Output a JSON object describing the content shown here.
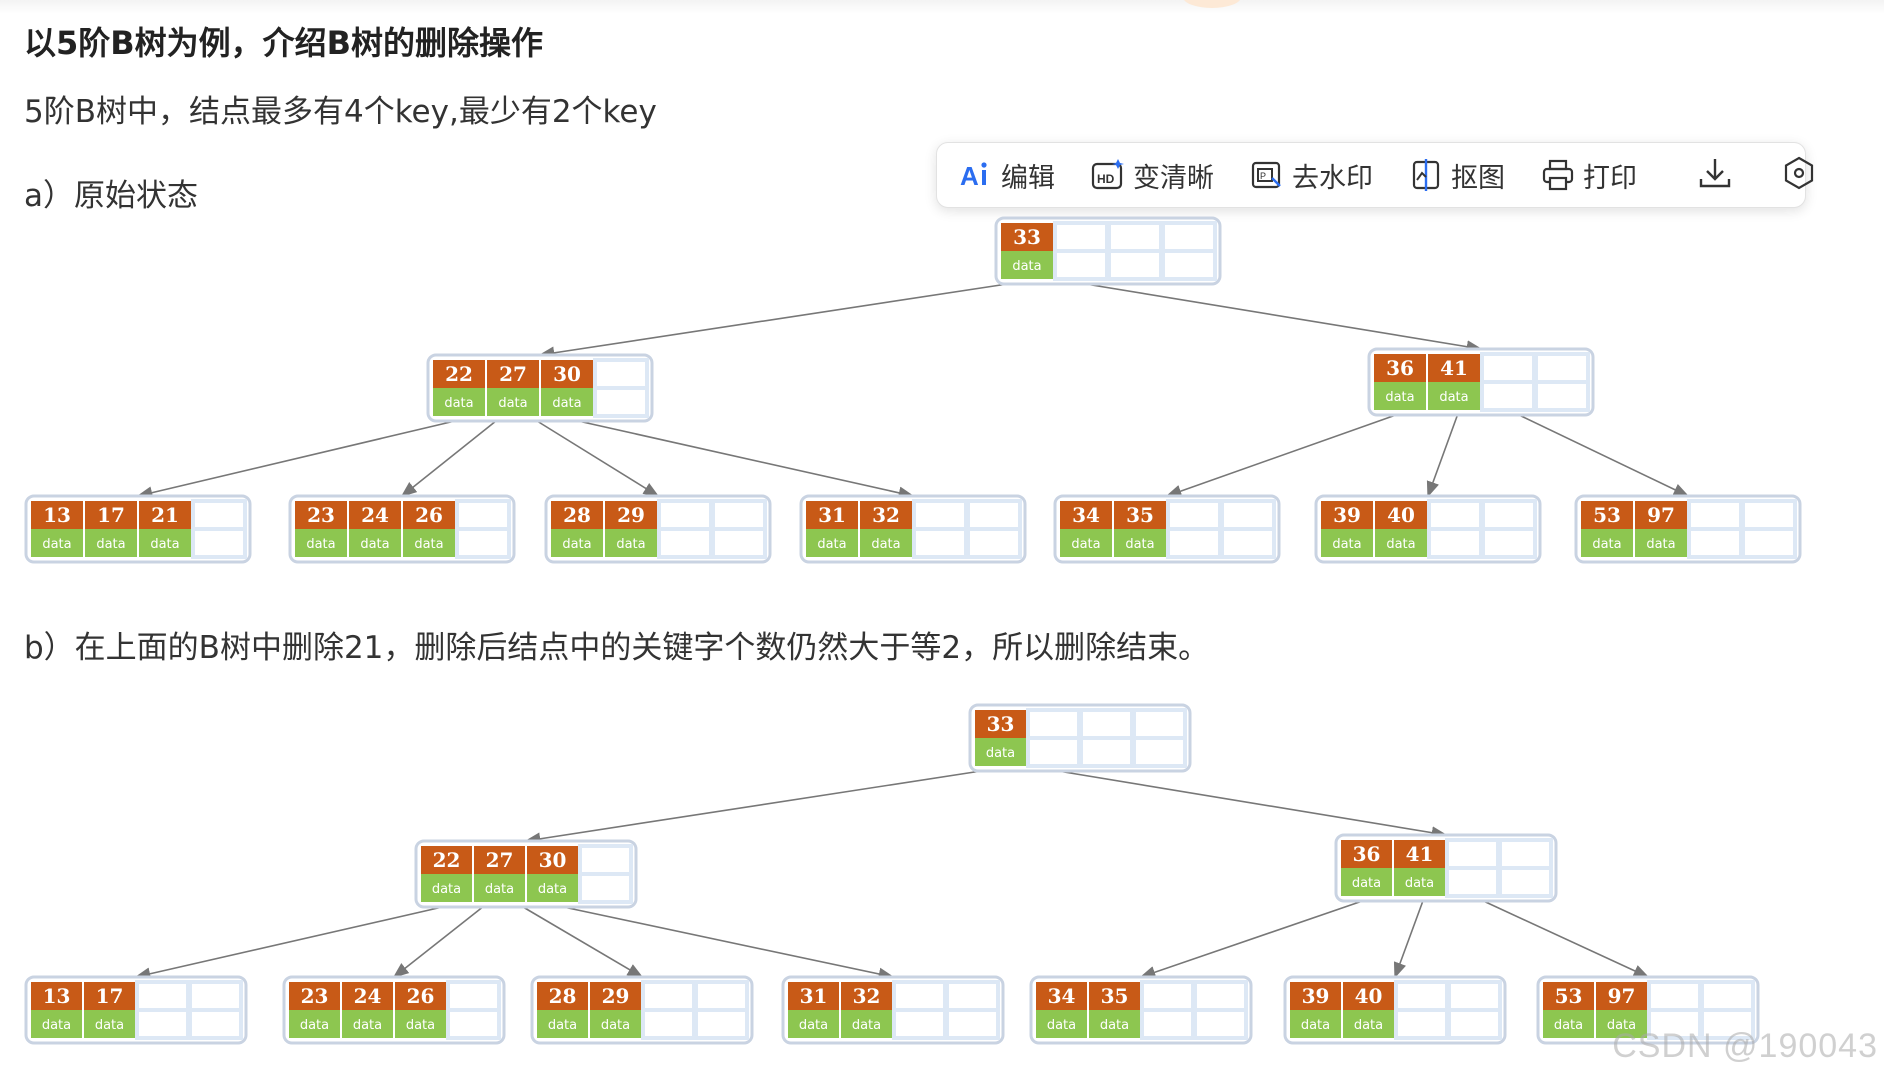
{
  "article": {
    "heading": "以5阶B树为例，介绍B树的删除操作",
    "line1": "5阶B树中，结点最多有4个key,最少有2个key",
    "label_a": "a）原始状态",
    "label_b": "b）在上面的B树中删除21，删除后结点中的关键字个数仍然大于等2，所以删除结束。"
  },
  "toolbar": {
    "edit": "编辑",
    "enhance": "变清晰",
    "remove_watermark": "去水印",
    "cutout": "抠图",
    "print": "打印",
    "accent_color": "#2b6df0",
    "icons": [
      "ai-edit-icon",
      "hd-icon",
      "watermark-remove-icon",
      "cutout-icon",
      "printer-icon",
      "download-icon",
      "settings-hexagon-icon"
    ]
  },
  "watermark": "CSDN @190043",
  "colors": {
    "key_cell": "#c85a17",
    "data_cell": "#8dc650",
    "empty_cell": "#dde8f5",
    "node_border": "#c9d3e2",
    "edge": "#777777"
  },
  "trees": [
    {
      "id": "a",
      "data_label": "data",
      "nodes": [
        {
          "id": "root",
          "keys": [
            "33"
          ],
          "children": [
            "n1",
            "n2"
          ]
        },
        {
          "id": "n1",
          "keys": [
            "22",
            "27",
            "30"
          ],
          "children": [
            "l1",
            "l2",
            "l3",
            "l4"
          ]
        },
        {
          "id": "n2",
          "keys": [
            "36",
            "41"
          ],
          "children": [
            "l5",
            "l6",
            "l7"
          ]
        },
        {
          "id": "l1",
          "keys": [
            "13",
            "17",
            "21"
          ]
        },
        {
          "id": "l2",
          "keys": [
            "23",
            "24",
            "26"
          ]
        },
        {
          "id": "l3",
          "keys": [
            "28",
            "29"
          ]
        },
        {
          "id": "l4",
          "keys": [
            "31",
            "32"
          ]
        },
        {
          "id": "l5",
          "keys": [
            "34",
            "35"
          ]
        },
        {
          "id": "l6",
          "keys": [
            "39",
            "40"
          ]
        },
        {
          "id": "l7",
          "keys": [
            "53",
            "97"
          ]
        }
      ]
    },
    {
      "id": "b",
      "data_label": "data",
      "nodes": [
        {
          "id": "root",
          "keys": [
            "33"
          ],
          "children": [
            "n1",
            "n2"
          ]
        },
        {
          "id": "n1",
          "keys": [
            "22",
            "27",
            "30"
          ],
          "children": [
            "l1",
            "l2",
            "l3",
            "l4"
          ]
        },
        {
          "id": "n2",
          "keys": [
            "36",
            "41"
          ],
          "children": [
            "l5",
            "l6",
            "l7"
          ]
        },
        {
          "id": "l1",
          "keys": [
            "13",
            "17"
          ]
        },
        {
          "id": "l2",
          "keys": [
            "23",
            "24",
            "26"
          ]
        },
        {
          "id": "l3",
          "keys": [
            "28",
            "29"
          ]
        },
        {
          "id": "l4",
          "keys": [
            "31",
            "32"
          ]
        },
        {
          "id": "l5",
          "keys": [
            "34",
            "35"
          ]
        },
        {
          "id": "l6",
          "keys": [
            "39",
            "40"
          ]
        },
        {
          "id": "l7",
          "keys": [
            "53",
            "97"
          ]
        }
      ]
    }
  ]
}
